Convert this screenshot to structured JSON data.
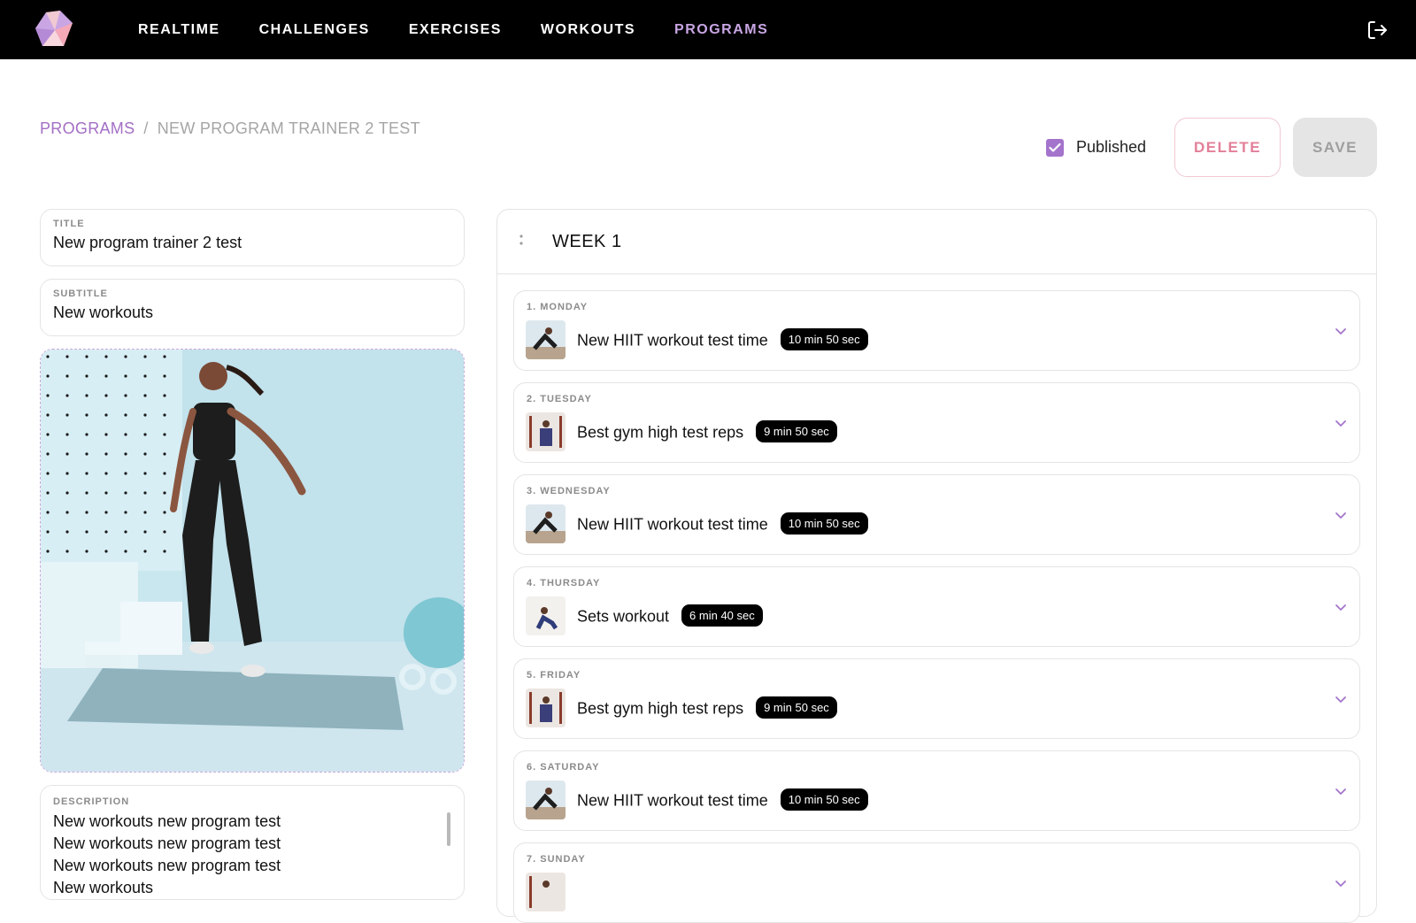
{
  "nav": {
    "items": [
      {
        "label": "REALTIME",
        "active": false
      },
      {
        "label": "CHALLENGES",
        "active": false
      },
      {
        "label": "EXERCISES",
        "active": false
      },
      {
        "label": "WORKOUTS",
        "active": false
      },
      {
        "label": "PROGRAMS",
        "active": true
      }
    ],
    "logout_icon": "logout-icon"
  },
  "breadcrumb": {
    "root": "PROGRAMS",
    "separator": "/",
    "current": "NEW PROGRAM TRAINER 2 TEST"
  },
  "actions": {
    "published_label": "Published",
    "published_checked": true,
    "delete_label": "DELETE",
    "save_label": "SAVE"
  },
  "form": {
    "title_label": "TITLE",
    "title_value": "New program trainer 2 test",
    "subtitle_label": "SUBTITLE",
    "subtitle_value": "New workouts",
    "description_label": "DESCRIPTION",
    "description_lines": [
      "New workouts new program test",
      "New workouts new program test",
      "New workouts new program test",
      "New workouts"
    ]
  },
  "week": {
    "title": "WEEK 1",
    "days": [
      {
        "label": "1. MONDAY",
        "workout": "New HIIT workout test time",
        "duration": "10 min 50 sec"
      },
      {
        "label": "2. TUESDAY",
        "workout": "Best gym high test reps",
        "duration": "9 min 50 sec"
      },
      {
        "label": "3. WEDNESDAY",
        "workout": "New HIIT workout test time",
        "duration": "10 min 50 sec"
      },
      {
        "label": "4. THURSDAY",
        "workout": "Sets workout",
        "duration": "6 min 40 sec"
      },
      {
        "label": "5. FRIDAY",
        "workout": "Best gym high test reps",
        "duration": "9 min 50 sec"
      },
      {
        "label": "6. SATURDAY",
        "workout": "New HIIT workout test time",
        "duration": "10 min 50 sec"
      },
      {
        "label": "7. SUNDAY",
        "workout": "",
        "duration": ""
      }
    ]
  },
  "colors": {
    "accent": "#a474cc",
    "nav_active": "#c9a6e3",
    "delete": "#e37f99"
  }
}
